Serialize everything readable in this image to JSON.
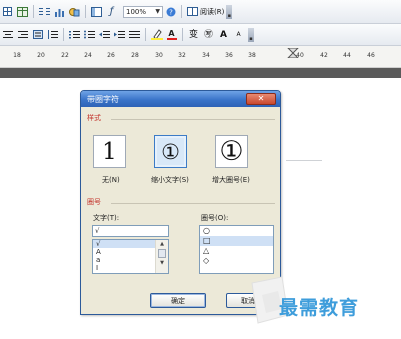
{
  "toolbar1": {
    "zoom_value": "100%",
    "read_label": "阅读(R)",
    "end_glyph": "▪"
  },
  "toolbar2": {
    "font_color_label": "A",
    "phonetic_label": "变",
    "enclose_label": "㊢",
    "grow_font_label": "A",
    "shrink_font_label": "A"
  },
  "ruler": {
    "ticks": [
      "18",
      "20",
      "22",
      "24",
      "26",
      "28",
      "30",
      "32",
      "34",
      "36",
      "38",
      "40",
      "42",
      "44",
      "46"
    ]
  },
  "dialog": {
    "title": "带圈字符",
    "close_glyph": "✕",
    "style_section": "样式",
    "styles": [
      {
        "glyph": "1",
        "caption": "无(N)"
      },
      {
        "glyph": "①",
        "caption": "缩小文字(S)"
      },
      {
        "glyph": "①",
        "caption": "增大圈号(E)"
      }
    ],
    "enclosure_section": "圈号",
    "text_label": "文字(T):",
    "text_value": "√",
    "text_items": [
      "√",
      "A",
      "a",
      "I"
    ],
    "symbol_label": "圈号(O):",
    "symbol_items": [
      "○",
      "□",
      "△",
      "◇"
    ],
    "ok_label": "确定",
    "cancel_label": "取消"
  },
  "watermark": {
    "text": "最需教育"
  },
  "colors": {
    "title_bar": "#3a74c9",
    "section_label": "#c3332b",
    "selection": "#cfe0f5",
    "watermark": "#3e9ddb"
  }
}
